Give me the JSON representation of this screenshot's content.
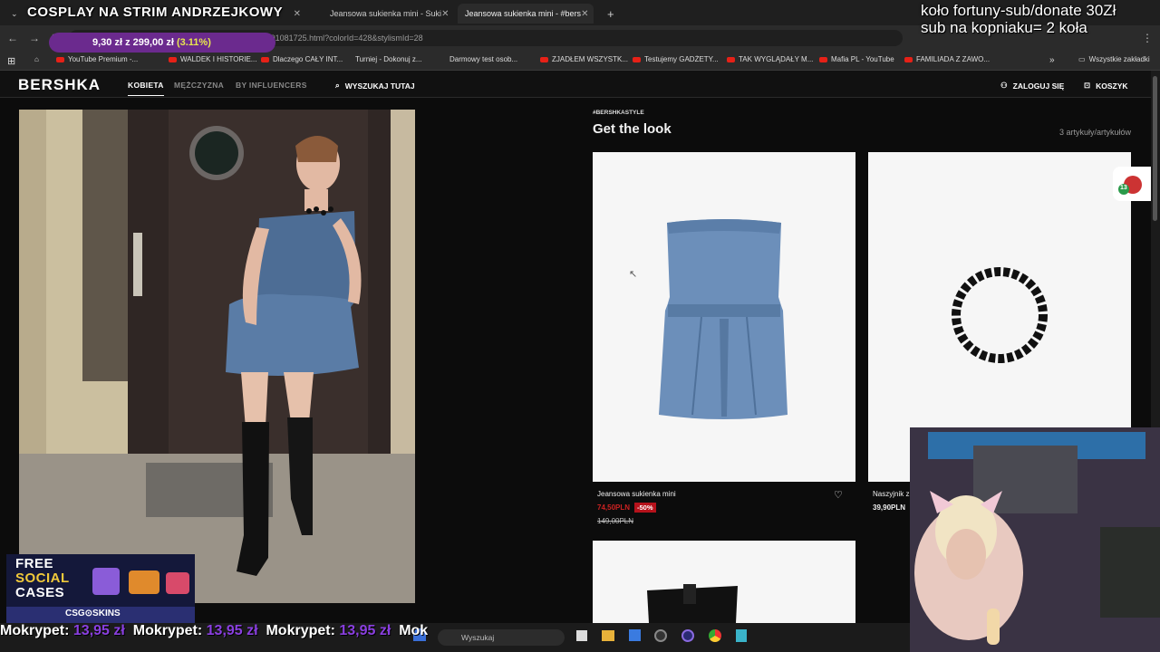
{
  "browser": {
    "tabs": [
      {
        "label": "COSPLAY NA STRIM ANDRZEJKOWY"
      },
      {
        "label": "Jeansowa sukienka mini - Suki"
      },
      {
        "label": "Jeansowa sukienka mini - #bers"
      }
    ],
    "url": "bershka.com/.../jeansowa-sukienka-mini-c0p201081725.html?colorId=428&stylismId=28",
    "bookmarks": [
      "YouTube Premium -...",
      "WALDEK I HISTORIE...",
      "Dlaczego CAŁY INT...",
      "Turniej - Dokonuj z...",
      "Darmowy test osob...",
      "ZJADŁEM WSZYSTK...",
      "Testujemy GADŻETY...",
      "TAK WYGLĄDAŁY M...",
      "Mafia PL - YouTube",
      "FAMILIADA Z ZAWO..."
    ],
    "all_bookmarks": "Wszystkie zakładki"
  },
  "site": {
    "logo": "BERSHKA",
    "nav": [
      "KOBIETA",
      "MĘŻCZYZNA",
      "BY INFLUENCERS"
    ],
    "search_label": "WYSZUKAJ TUTAJ",
    "login_label": "ZALOGUJ SIĘ",
    "cart_label": "KOSZYK"
  },
  "look": {
    "tag": "#BERSHKASTYLE",
    "title": "Get the look",
    "count": "3 artykuły/artykułów",
    "products": [
      {
        "name": "Jeansowa sukienka mini",
        "sale_price": "74,50PLN",
        "discount": "-50%",
        "old_price": "149,00PLN"
      },
      {
        "name": "Naszyjnik z",
        "price": "39,90PLN"
      }
    ]
  },
  "overlay": {
    "donate_amount": "9,30 zł z 299,00 zł",
    "donate_pct": "(3.11%)",
    "topright_line1": "koło fortuny-sub/donate 30Zł",
    "topright_line2": "sub na kopniaku= 2 koła",
    "ticker_name": "Mokrypet:",
    "ticker_amount": "13,95 zł",
    "ticker_tail": "Mok",
    "promo_line1": "FREE",
    "promo_line2": "SOCIAL",
    "promo_line3": "CASES",
    "promo_brand": "CSG⊙SKINS",
    "chat_badge": "13"
  },
  "taskbar": {
    "search_placeholder": "Wyszukaj"
  }
}
